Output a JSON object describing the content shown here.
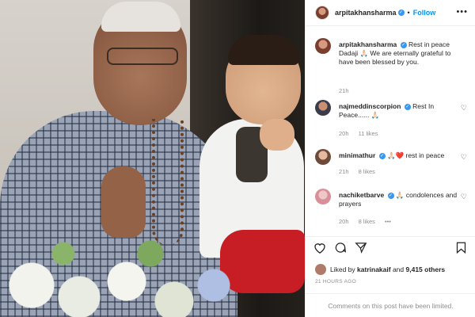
{
  "post": {
    "author": "arpitakhansharma",
    "follow_label": "Follow",
    "separator": "•",
    "more_icon": "more-horizontal-icon"
  },
  "caption": {
    "user": "arpitakhansharma",
    "text": "Rest in peace Dadaji 🙏🏻 We are eternally grateful to have been blessed by you.",
    "time": "21h"
  },
  "comments": [
    {
      "user": "najmeddinscorpion",
      "text": "Rest In Peace...... 🙏🏻",
      "time": "20h",
      "likes": "11 likes",
      "reply": ""
    },
    {
      "user": "minimathur",
      "text": "🙏🏻❤️ rest in peace",
      "time": "21h",
      "likes": "8 likes",
      "reply": ""
    },
    {
      "user": "nachiketbarve",
      "text": "🙏🏻 condolences and prayers",
      "time": "20h",
      "likes": "8 likes",
      "reply": "•••"
    }
  ],
  "likes": {
    "prefix": "Liked by",
    "user": "katrinakaif",
    "and": "and",
    "count": "9,415 others"
  },
  "timestamp": "21 HOURS AGO",
  "comments_disabled": "Comments on this post have been limited.",
  "colors": {
    "accent": "#0095f6",
    "verified": "#3897f0",
    "muted": "#8e8e8e",
    "text": "#262626"
  }
}
